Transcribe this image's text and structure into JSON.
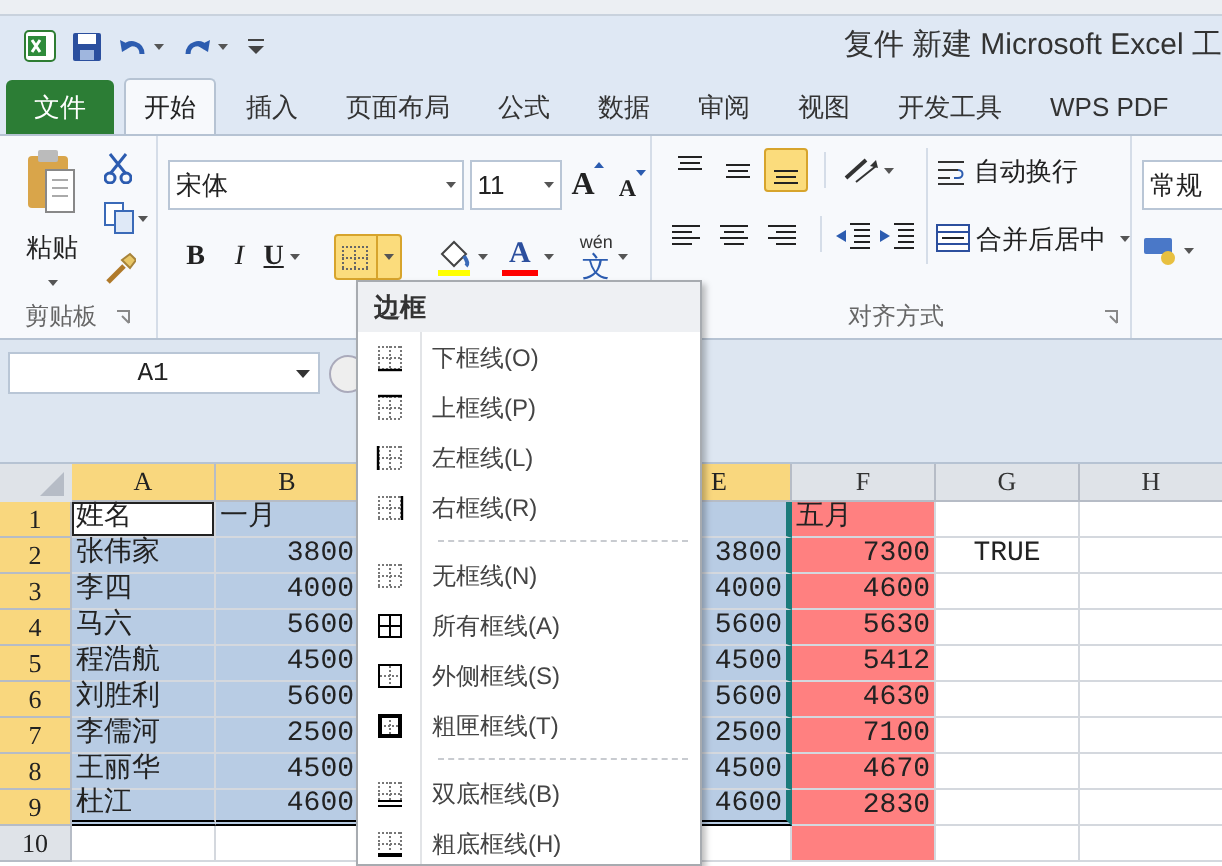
{
  "window": {
    "title": "复件 新建 Microsoft Excel 工"
  },
  "tabs": [
    {
      "label": "文件",
      "kind": "file",
      "selected": false
    },
    {
      "label": "开始",
      "kind": "tab",
      "selected": true
    },
    {
      "label": "插入",
      "kind": "tab",
      "selected": false
    },
    {
      "label": "页面布局",
      "kind": "tab",
      "selected": false
    },
    {
      "label": "公式",
      "kind": "tab",
      "selected": false
    },
    {
      "label": "数据",
      "kind": "tab",
      "selected": false
    },
    {
      "label": "审阅",
      "kind": "tab",
      "selected": false
    },
    {
      "label": "视图",
      "kind": "tab",
      "selected": false
    },
    {
      "label": "开发工具",
      "kind": "tab",
      "selected": false
    },
    {
      "label": "WPS PDF",
      "kind": "tab",
      "selected": false
    }
  ],
  "ribbon": {
    "clipboard": {
      "paste_label": "粘贴",
      "group_label": "剪贴板"
    },
    "font": {
      "font_name": "宋体",
      "font_size": "11",
      "grow": "A",
      "shrink": "A",
      "bold": "B",
      "italic": "I",
      "underline": "U",
      "font_color_letter": "A",
      "phonetic_top": "wén",
      "phonetic_bottom": "文",
      "border_button_selected": true
    },
    "alignment": {
      "vertical": [
        {
          "kind": "top",
          "selected": false
        },
        {
          "kind": "middle",
          "selected": false
        },
        {
          "kind": "bottom",
          "selected": true
        }
      ],
      "wrap_text": "自动换行",
      "merge_center": "合并后居中",
      "group_label": "对齐方式"
    },
    "number": {
      "format": "常规"
    }
  },
  "name_box": "A1",
  "border_menu": {
    "title": "边框",
    "groups": [
      [
        {
          "kind": "bottom",
          "label": "下框线(O)"
        },
        {
          "kind": "top",
          "label": "上框线(P)"
        },
        {
          "kind": "left",
          "label": "左框线(L)"
        },
        {
          "kind": "right",
          "label": "右框线(R)"
        }
      ],
      [
        {
          "kind": "none",
          "label": "无框线(N)"
        },
        {
          "kind": "all",
          "label": "所有框线(A)"
        },
        {
          "kind": "outside",
          "label": "外侧框线(S)"
        },
        {
          "kind": "thick-box",
          "label": "粗匣框线(T)"
        }
      ],
      [
        {
          "kind": "double-bottom",
          "label": "双底框线(B)"
        },
        {
          "kind": "thick-bottom",
          "label": "粗底框线(H)"
        }
      ]
    ]
  },
  "sheet": {
    "columns": [
      {
        "label": "A",
        "selected": true
      },
      {
        "label": "B",
        "selected": true
      },
      {
        "label": "E",
        "selected": true
      },
      {
        "label": "F",
        "selected": false,
        "color": "#ff8080"
      },
      {
        "label": "G",
        "selected": false
      },
      {
        "label": "H",
        "selected": false
      }
    ],
    "rows": [
      {
        "header": "1",
        "selected": true,
        "cells": [
          {
            "text": "姓名",
            "selected": true,
            "active": true
          },
          {
            "text": "一月",
            "selected": true,
            "active": false
          },
          {
            "selected": true,
            "active": false
          },
          {
            "text": "五月",
            "selected": false,
            "active": false
          },
          {
            "selected": false,
            "active": false
          },
          {
            "selected": false,
            "active": false
          }
        ]
      },
      {
        "header": "2",
        "selected": true,
        "cells": [
          {
            "text": "张伟家",
            "selected": true,
            "active": false
          },
          {
            "text": "3800",
            "selected": true,
            "active": false
          },
          {
            "text": "3800",
            "selected": true,
            "active": false
          },
          {
            "text": "7300",
            "selected": false,
            "active": false
          },
          {
            "text": "TRUE",
            "selected": false,
            "active": false
          },
          {
            "selected": false,
            "active": false
          }
        ]
      },
      {
        "header": "3",
        "selected": true,
        "cells": [
          {
            "text": "李四",
            "selected": true,
            "active": false
          },
          {
            "text": "4000",
            "selected": true,
            "active": false
          },
          {
            "text": "4000",
            "selected": true,
            "active": false
          },
          {
            "text": "4600",
            "selected": false,
            "active": false
          },
          {
            "selected": false,
            "active": false
          },
          {
            "selected": false,
            "active": false
          }
        ]
      },
      {
        "header": "4",
        "selected": true,
        "cells": [
          {
            "text": "马六",
            "selected": true,
            "active": false
          },
          {
            "text": "5600",
            "selected": true,
            "active": false
          },
          {
            "text": "5600",
            "selected": true,
            "active": false
          },
          {
            "text": "5630",
            "selected": false,
            "active": false
          },
          {
            "selected": false,
            "active": false
          },
          {
            "selected": false,
            "active": false
          }
        ]
      },
      {
        "header": "5",
        "selected": true,
        "cells": [
          {
            "text": "程浩航",
            "selected": true,
            "active": false
          },
          {
            "text": "4500",
            "selected": true,
            "active": false
          },
          {
            "text": "4500",
            "selected": true,
            "active": false
          },
          {
            "text": "5412",
            "selected": false,
            "active": false
          },
          {
            "selected": false,
            "active": false
          },
          {
            "selected": false,
            "active": false
          }
        ]
      },
      {
        "header": "6",
        "selected": true,
        "cells": [
          {
            "text": "刘胜利",
            "selected": true,
            "active": false
          },
          {
            "text": "5600",
            "selected": true,
            "active": false
          },
          {
            "text": "5600",
            "selected": true,
            "active": false
          },
          {
            "text": "4630",
            "selected": false,
            "active": false
          },
          {
            "selected": false,
            "active": false
          },
          {
            "selected": false,
            "active": false
          }
        ]
      },
      {
        "header": "7",
        "selected": true,
        "cells": [
          {
            "text": "李儒河",
            "selected": true,
            "active": false
          },
          {
            "text": "2500",
            "selected": true,
            "active": false
          },
          {
            "text": "2500",
            "selected": true,
            "active": false
          },
          {
            "text": "7100",
            "selected": false,
            "active": false
          },
          {
            "selected": false,
            "active": false
          },
          {
            "selected": false,
            "active": false
          }
        ]
      },
      {
        "header": "8",
        "selected": true,
        "cells": [
          {
            "text": "王丽华",
            "selected": true,
            "active": false
          },
          {
            "text": "4500",
            "selected": true,
            "active": false
          },
          {
            "text": "4500",
            "selected": true,
            "active": false
          },
          {
            "text": "4670",
            "selected": false,
            "active": false
          },
          {
            "selected": false,
            "active": false
          },
          {
            "selected": false,
            "active": false
          }
        ]
      },
      {
        "header": "9",
        "selected": true,
        "cells": [
          {
            "text": "杜江",
            "selected": true,
            "active": false
          },
          {
            "text": "4600",
            "selected": true,
            "active": false
          },
          {
            "text": "4600",
            "selected": true,
            "active": false
          },
          {
            "text": "2830",
            "selected": false,
            "active": false
          },
          {
            "selected": false,
            "active": false
          },
          {
            "selected": false,
            "active": false
          }
        ]
      },
      {
        "header": "10",
        "selected": false,
        "cells": [
          {
            "selected": false,
            "active": false
          },
          {
            "selected": false,
            "active": false
          },
          {
            "selected": false,
            "active": false
          },
          {
            "selected": false,
            "active": false
          },
          {
            "selected": false,
            "active": false
          },
          {
            "selected": false,
            "active": false
          }
        ]
      }
    ]
  }
}
